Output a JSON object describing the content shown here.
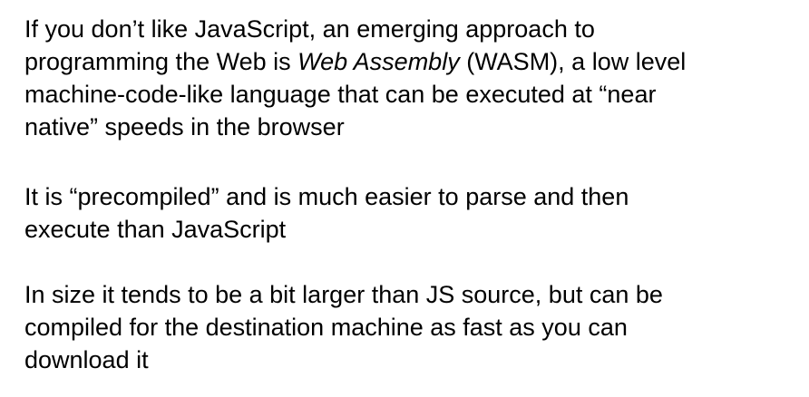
{
  "paragraphs": [
    {
      "lines": [
        {
          "text": "If you don’t like JavaScript, an emerging approach to"
        },
        {
          "before": "programming the Web is ",
          "emphasis": "Web Assembly",
          "after": " (WASM), a low level"
        },
        {
          "text": "machine-code-like language that can be executed at “near"
        },
        {
          "text": "native” speeds in the browser"
        }
      ]
    },
    {
      "lines": [
        {
          "text": "It is “precompiled” and is much easier to parse and then"
        },
        {
          "text": "execute than JavaScript"
        }
      ]
    },
    {
      "lines": [
        {
          "text": "In size it tends to be a bit larger than JS source, but can be"
        },
        {
          "text": "compiled for the destination machine as fast as you can"
        },
        {
          "text": "download it"
        }
      ]
    }
  ]
}
